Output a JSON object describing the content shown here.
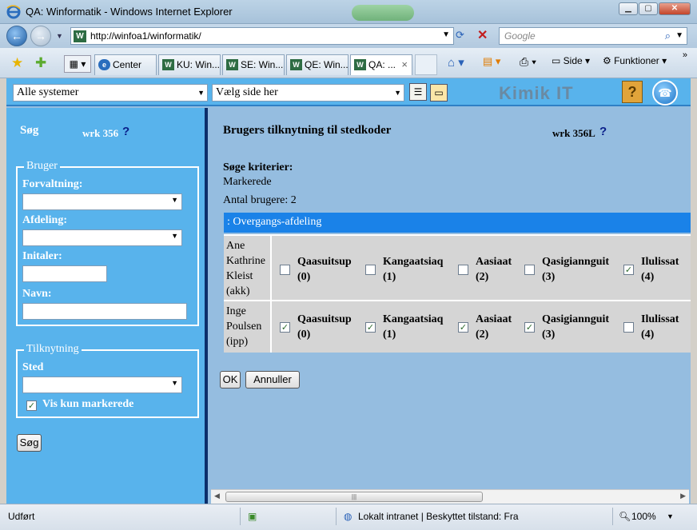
{
  "window": {
    "title": "QA: Winformatik    - Windows Internet Explorer",
    "buttons": {
      "minimize": "▁",
      "maximize": "▢",
      "close": "✕"
    }
  },
  "address": {
    "url": "http://winfoa1/winformatik/",
    "search_placeholder": "Google"
  },
  "tabs": [
    {
      "label": "Center",
      "icon": "ie-icon"
    },
    {
      "label": "KU: Win...",
      "icon": "winformatik-icon"
    },
    {
      "label": "SE: Win...",
      "icon": "winformatik-icon"
    },
    {
      "label": "QE: Win...",
      "icon": "winformatik-icon"
    },
    {
      "label": "QA: ...",
      "icon": "winformatik-icon",
      "active": true
    }
  ],
  "toolbar": {
    "page": "Side",
    "tools": "Funktioner",
    "more": "»"
  },
  "topbar": {
    "system_select": "Alle systemer",
    "page_select": "Vælg side her",
    "brand": "Kimik IT",
    "help": "?"
  },
  "left": {
    "search_title": "Søg",
    "code": "wrk 356",
    "help": "?",
    "bruger_legend": "Bruger",
    "forvaltning_label": "Forvaltning:",
    "afdeling_label": "Afdeling:",
    "initialer_label": "Initaler:",
    "navn_label": "Navn:",
    "tilknytning_legend": "Tilknytning",
    "sted_label": "Sted",
    "vis_kun_label": "Vis kun markerede",
    "vis_kun_checked": true,
    "search_button": "Søg"
  },
  "main": {
    "title": "Brugers tilknytning til stedkoder",
    "code": "wrk 356L",
    "help": "?",
    "criteria_label": "Søge kriterier:",
    "criteria_value": "Markerede",
    "count_text": "Antal brugere: 2",
    "group": ": Overgangs-afdeling",
    "users": [
      {
        "name": "Ane Kathrine Kleist (akk)",
        "name_lines": [
          "Ane",
          "Kathrine",
          "Kleist",
          "(akk)"
        ],
        "places": [
          {
            "name": "Qaasuitsup",
            "code": "(0)",
            "checked": false
          },
          {
            "name": "Kangaatsiaq",
            "code": "(1)",
            "checked": false
          },
          {
            "name": "Aasiaat",
            "code": "(2)",
            "checked": false
          },
          {
            "name": "Qasigiannguit",
            "code": "(3)",
            "checked": false
          },
          {
            "name": "Ilulissat",
            "code": "(4)",
            "checked": true
          }
        ]
      },
      {
        "name": "Inge Poulsen (ipp)",
        "name_lines": [
          "Inge",
          "Poulsen",
          "(ipp)"
        ],
        "places": [
          {
            "name": "Qaasuitsup",
            "code": "(0)",
            "checked": true
          },
          {
            "name": "Kangaatsiaq",
            "code": "(1)",
            "checked": true
          },
          {
            "name": "Aasiaat",
            "code": "(2)",
            "checked": true
          },
          {
            "name": "Qasigiannguit",
            "code": "(3)",
            "checked": true
          },
          {
            "name": "Ilulissat",
            "code": "(4)",
            "checked": false
          }
        ]
      }
    ],
    "ok_button": "OK",
    "cancel_button": "Annuller"
  },
  "status": {
    "text": "Udført",
    "zone": "Lokalt intranet | Beskyttet tilstand: Fra",
    "zoom": "100%"
  }
}
